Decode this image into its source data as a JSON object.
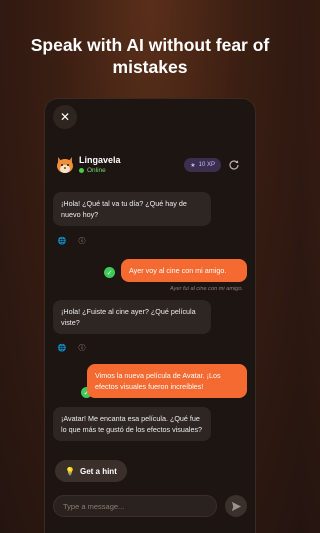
{
  "headline": "Speak with AI without fear of mistakes",
  "chat": {
    "bot_name": "Lingavela",
    "status": "Online",
    "xp": "10 XP",
    "messages": [
      {
        "from": "bot",
        "text": "¡Hola! ¿Qué tal va tu día? ¿Qué hay de nuevo hoy?"
      },
      {
        "from": "user",
        "text": "Ayer voy al cine con mi amigo.",
        "correction": "Ayer fui al cine con mi amigo."
      },
      {
        "from": "bot",
        "text": "¡Hola! ¿Fuiste al cine ayer? ¿Qué película viste?"
      },
      {
        "from": "user",
        "text": "Vimos la nueva película de Avatar. ¡Los efectos visuales fueron increíbles!"
      },
      {
        "from": "bot",
        "text": "¡Avatar! Me encanta esa película. ¿Qué fue lo que más te gustó de los efectos visuales?"
      }
    ],
    "hint_label": "Get a hint",
    "input_placeholder": "Type a message..."
  },
  "colors": {
    "accent": "#f56a30",
    "bot_bubble": "#2e2623",
    "online": "#4cc94a",
    "check": "#3fc95a"
  }
}
